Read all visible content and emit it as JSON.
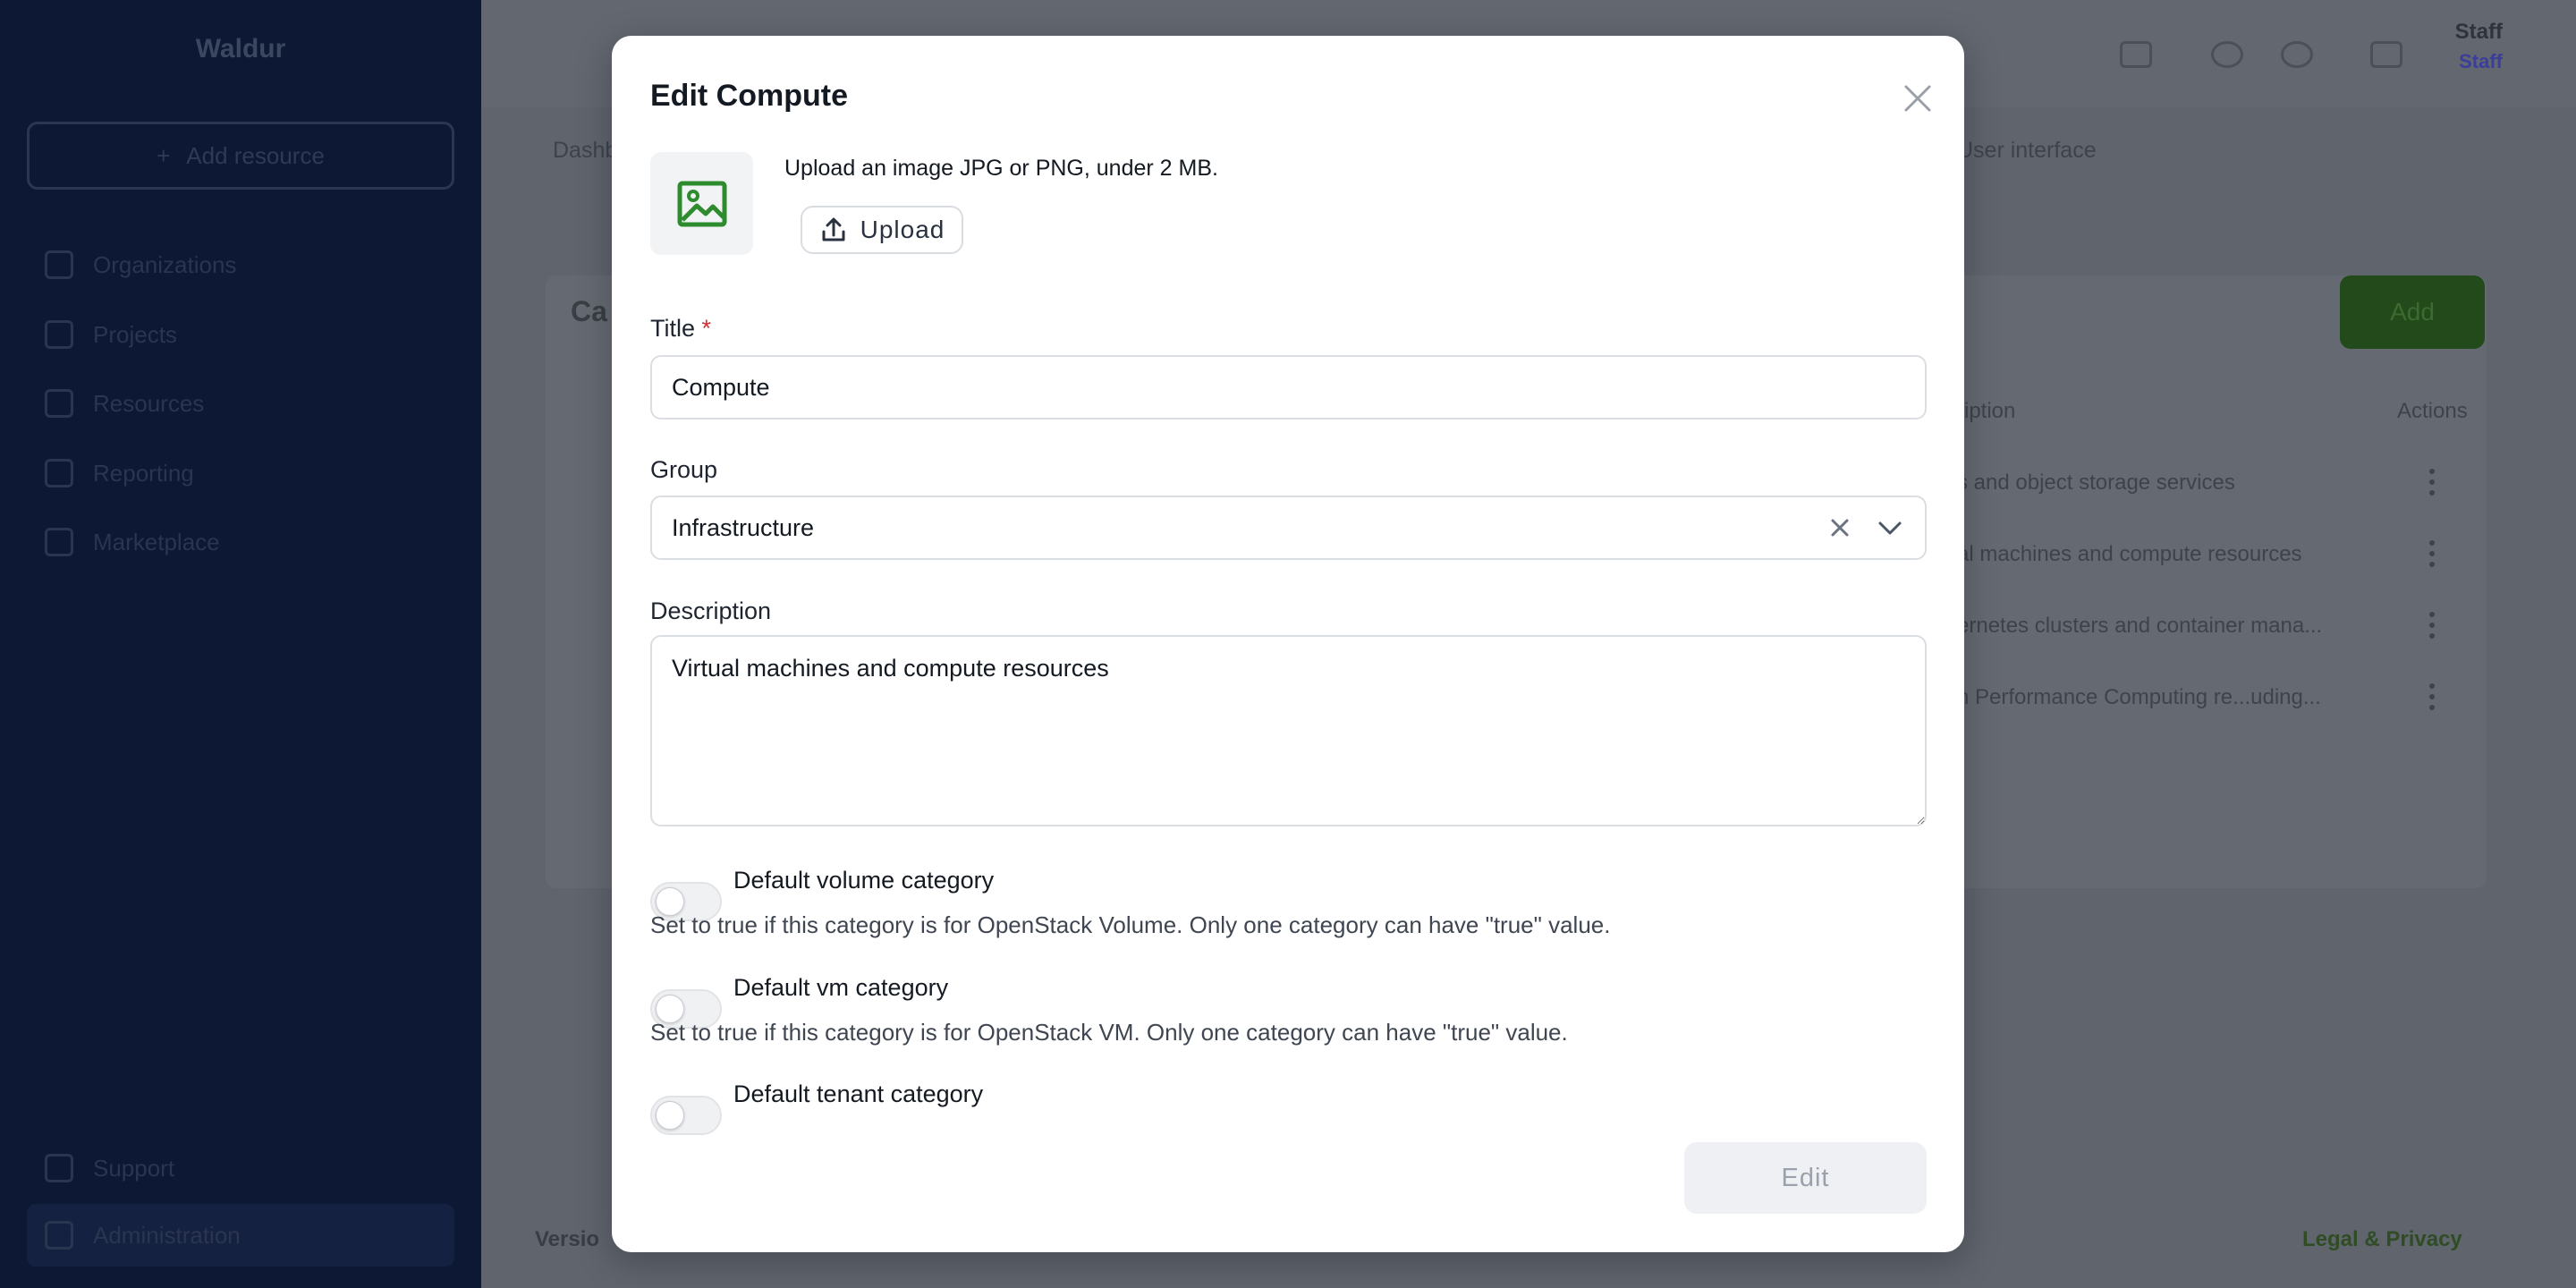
{
  "background": {
    "brand": "Waldur",
    "add_resource": "Add resource",
    "nav": [
      "Organizations",
      "Projects",
      "Resources",
      "Reporting",
      "Marketplace"
    ],
    "nav_bottom": [
      "Support",
      "Administration"
    ],
    "breadcrumb": "Dashb",
    "user_interface_label": "User interface",
    "user_name": "Staff",
    "user_role": "Staff",
    "card_title": "Ca",
    "add_button": "Add",
    "table_header_desc": "ription",
    "table_header_actions": "Actions",
    "rows": [
      "s and object storage services",
      "al machines and compute resources",
      "ernetes clusters and container mana...",
      "h Performance Computing re...uding..."
    ],
    "footer_left": "Versio",
    "footer_right": "Legal & Privacy"
  },
  "modal": {
    "title": "Edit Compute",
    "upload_hint": "Upload an image JPG or PNG, under 2 MB.",
    "upload_label": "Upload",
    "title_label": "Title",
    "required_mark": "*",
    "title_value": "Compute",
    "group_label": "Group",
    "group_value": "Infrastructure",
    "description_label": "Description",
    "description_value": "Virtual machines and compute resources",
    "toggles": [
      {
        "label": "Default volume category",
        "help": "Set to true if this category is for OpenStack Volume. Only one category can have \"true\" value.",
        "on": false
      },
      {
        "label": "Default vm category",
        "help": "Set to true if this category is for OpenStack VM. Only one category can have \"true\" value.",
        "on": false
      },
      {
        "label": "Default tenant category",
        "on": false
      }
    ],
    "submit_label": "Edit"
  },
  "colors": {
    "image_icon": "#2e8b2e",
    "required": "#d22f2f",
    "sidebar": "#0d1834"
  }
}
